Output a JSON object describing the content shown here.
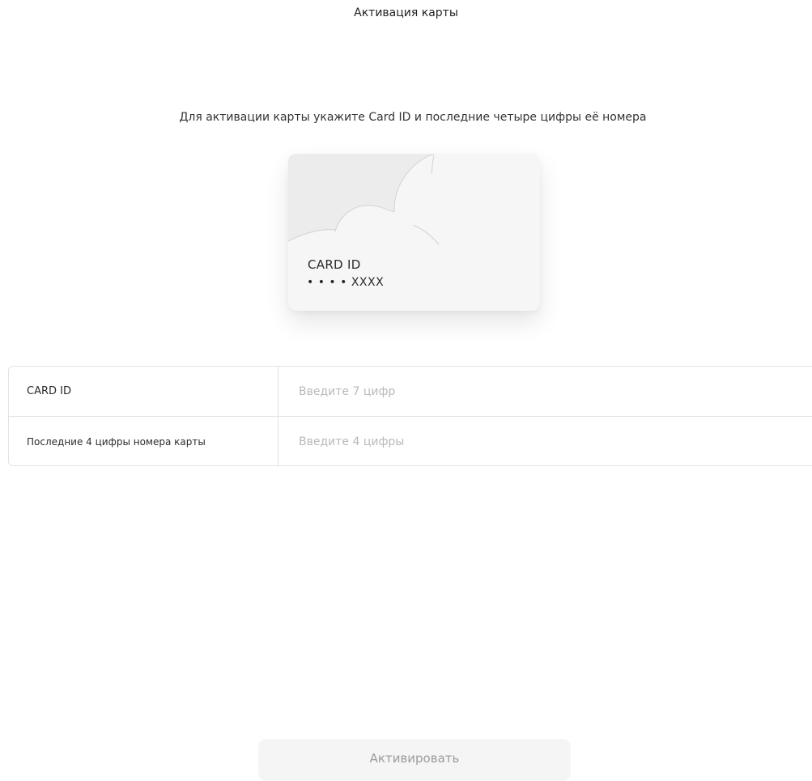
{
  "header": {
    "title": "Активация карты"
  },
  "instruction": {
    "text": "Для активации карты укажите Card ID и последние четыре цифры её номера"
  },
  "card_preview": {
    "card_id_label": "CARD ID",
    "number_mask": "• • • • XXXX"
  },
  "form": {
    "rows": [
      {
        "label": "CARD ID",
        "placeholder": "Введите 7 цифр",
        "value": ""
      },
      {
        "label": "Последние 4 цифры номера карты",
        "placeholder": "Введите 4 цифры",
        "value": ""
      }
    ]
  },
  "actions": {
    "activate_label": "Активировать",
    "activate_enabled": false
  },
  "colors": {
    "card_background": "#f6f6f6",
    "button_background": "#f5f5f5",
    "button_text_disabled": "#9b9b9b",
    "placeholder": "#b9b9b9",
    "border": "#e3e3e3"
  }
}
